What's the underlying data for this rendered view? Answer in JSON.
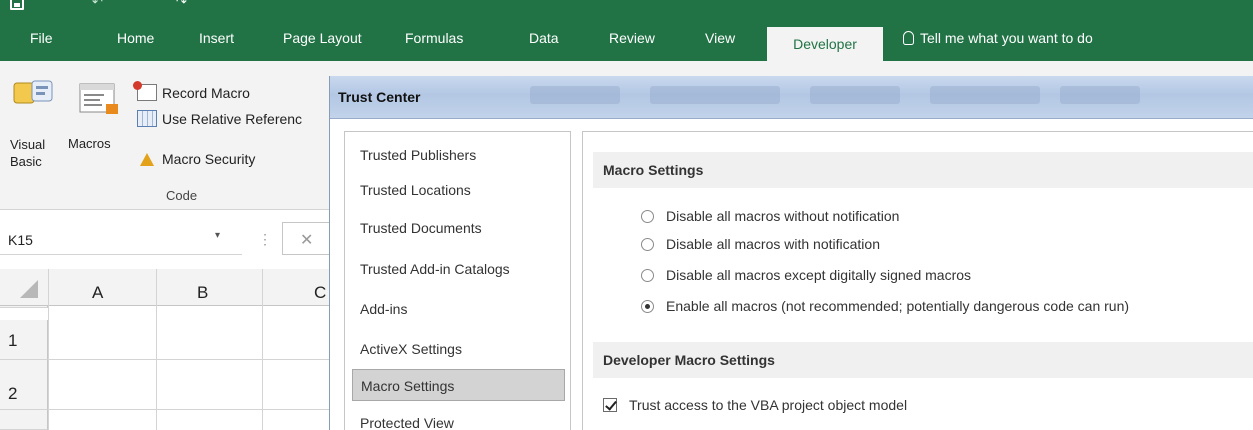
{
  "ribbon_tabs": [
    "File",
    "Home",
    "Insert",
    "Page Layout",
    "Formulas",
    "Data",
    "Review",
    "View"
  ],
  "active_tab": "Developer",
  "tell_me": "Tell me what you want to do",
  "code_group": {
    "visual_basic": [
      "Visual",
      "Basic"
    ],
    "macros": "Macros",
    "record_macro": "Record Macro",
    "use_relative": "Use Relative Referenc",
    "macro_security": "Macro Security",
    "group_label": "Code"
  },
  "formula_bar": {
    "name_box": "K15",
    "dropdown_glyph": "▾",
    "separator_glyph": "⋮",
    "cancel_glyph": "✕"
  },
  "grid": {
    "columns": [
      "A",
      "B",
      "C"
    ],
    "rows": [
      "1",
      "2"
    ]
  },
  "dialog": {
    "title": "Trust Center",
    "nav_items": [
      "Trusted Publishers",
      "Trusted Locations",
      "Trusted Documents",
      "Trusted Add-in Catalogs",
      "Add-ins",
      "ActiveX Settings",
      "Macro Settings",
      "Protected View"
    ],
    "selected_nav": "Macro Settings",
    "macro_settings_head": "Macro Settings",
    "macro_options": [
      "Disable all macros without notification",
      "Disable all macros with notification",
      "Disable all macros except digitally signed macros",
      "Enable all macros (not recommended; potentially dangerous code can run)"
    ],
    "selected_macro_option": 3,
    "developer_head": "Developer Macro Settings",
    "trust_vba": "Trust access to the VBA project object model",
    "trust_vba_checked": true
  }
}
